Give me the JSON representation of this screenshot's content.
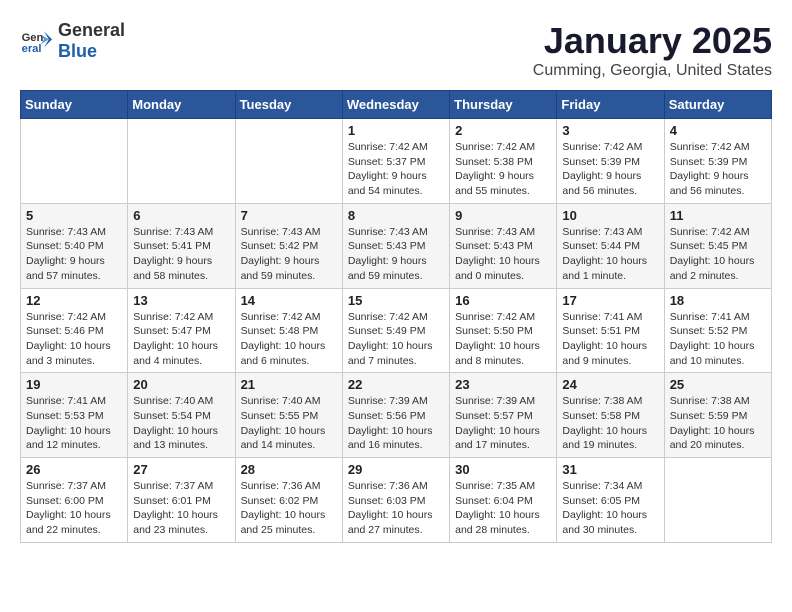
{
  "header": {
    "logo_general": "General",
    "logo_blue": "Blue",
    "month_title": "January 2025",
    "location": "Cumming, Georgia, United States"
  },
  "weekdays": [
    "Sunday",
    "Monday",
    "Tuesday",
    "Wednesday",
    "Thursday",
    "Friday",
    "Saturday"
  ],
  "weeks": [
    [
      {
        "day": "",
        "info": ""
      },
      {
        "day": "",
        "info": ""
      },
      {
        "day": "",
        "info": ""
      },
      {
        "day": "1",
        "info": "Sunrise: 7:42 AM\nSunset: 5:37 PM\nDaylight: 9 hours\nand 54 minutes."
      },
      {
        "day": "2",
        "info": "Sunrise: 7:42 AM\nSunset: 5:38 PM\nDaylight: 9 hours\nand 55 minutes."
      },
      {
        "day": "3",
        "info": "Sunrise: 7:42 AM\nSunset: 5:39 PM\nDaylight: 9 hours\nand 56 minutes."
      },
      {
        "day": "4",
        "info": "Sunrise: 7:42 AM\nSunset: 5:39 PM\nDaylight: 9 hours\nand 56 minutes."
      }
    ],
    [
      {
        "day": "5",
        "info": "Sunrise: 7:43 AM\nSunset: 5:40 PM\nDaylight: 9 hours\nand 57 minutes."
      },
      {
        "day": "6",
        "info": "Sunrise: 7:43 AM\nSunset: 5:41 PM\nDaylight: 9 hours\nand 58 minutes."
      },
      {
        "day": "7",
        "info": "Sunrise: 7:43 AM\nSunset: 5:42 PM\nDaylight: 9 hours\nand 59 minutes."
      },
      {
        "day": "8",
        "info": "Sunrise: 7:43 AM\nSunset: 5:43 PM\nDaylight: 9 hours\nand 59 minutes."
      },
      {
        "day": "9",
        "info": "Sunrise: 7:43 AM\nSunset: 5:43 PM\nDaylight: 10 hours\nand 0 minutes."
      },
      {
        "day": "10",
        "info": "Sunrise: 7:43 AM\nSunset: 5:44 PM\nDaylight: 10 hours\nand 1 minute."
      },
      {
        "day": "11",
        "info": "Sunrise: 7:42 AM\nSunset: 5:45 PM\nDaylight: 10 hours\nand 2 minutes."
      }
    ],
    [
      {
        "day": "12",
        "info": "Sunrise: 7:42 AM\nSunset: 5:46 PM\nDaylight: 10 hours\nand 3 minutes."
      },
      {
        "day": "13",
        "info": "Sunrise: 7:42 AM\nSunset: 5:47 PM\nDaylight: 10 hours\nand 4 minutes."
      },
      {
        "day": "14",
        "info": "Sunrise: 7:42 AM\nSunset: 5:48 PM\nDaylight: 10 hours\nand 6 minutes."
      },
      {
        "day": "15",
        "info": "Sunrise: 7:42 AM\nSunset: 5:49 PM\nDaylight: 10 hours\nand 7 minutes."
      },
      {
        "day": "16",
        "info": "Sunrise: 7:42 AM\nSunset: 5:50 PM\nDaylight: 10 hours\nand 8 minutes."
      },
      {
        "day": "17",
        "info": "Sunrise: 7:41 AM\nSunset: 5:51 PM\nDaylight: 10 hours\nand 9 minutes."
      },
      {
        "day": "18",
        "info": "Sunrise: 7:41 AM\nSunset: 5:52 PM\nDaylight: 10 hours\nand 10 minutes."
      }
    ],
    [
      {
        "day": "19",
        "info": "Sunrise: 7:41 AM\nSunset: 5:53 PM\nDaylight: 10 hours\nand 12 minutes."
      },
      {
        "day": "20",
        "info": "Sunrise: 7:40 AM\nSunset: 5:54 PM\nDaylight: 10 hours\nand 13 minutes."
      },
      {
        "day": "21",
        "info": "Sunrise: 7:40 AM\nSunset: 5:55 PM\nDaylight: 10 hours\nand 14 minutes."
      },
      {
        "day": "22",
        "info": "Sunrise: 7:39 AM\nSunset: 5:56 PM\nDaylight: 10 hours\nand 16 minutes."
      },
      {
        "day": "23",
        "info": "Sunrise: 7:39 AM\nSunset: 5:57 PM\nDaylight: 10 hours\nand 17 minutes."
      },
      {
        "day": "24",
        "info": "Sunrise: 7:38 AM\nSunset: 5:58 PM\nDaylight: 10 hours\nand 19 minutes."
      },
      {
        "day": "25",
        "info": "Sunrise: 7:38 AM\nSunset: 5:59 PM\nDaylight: 10 hours\nand 20 minutes."
      }
    ],
    [
      {
        "day": "26",
        "info": "Sunrise: 7:37 AM\nSunset: 6:00 PM\nDaylight: 10 hours\nand 22 minutes."
      },
      {
        "day": "27",
        "info": "Sunrise: 7:37 AM\nSunset: 6:01 PM\nDaylight: 10 hours\nand 23 minutes."
      },
      {
        "day": "28",
        "info": "Sunrise: 7:36 AM\nSunset: 6:02 PM\nDaylight: 10 hours\nand 25 minutes."
      },
      {
        "day": "29",
        "info": "Sunrise: 7:36 AM\nSunset: 6:03 PM\nDaylight: 10 hours\nand 27 minutes."
      },
      {
        "day": "30",
        "info": "Sunrise: 7:35 AM\nSunset: 6:04 PM\nDaylight: 10 hours\nand 28 minutes."
      },
      {
        "day": "31",
        "info": "Sunrise: 7:34 AM\nSunset: 6:05 PM\nDaylight: 10 hours\nand 30 minutes."
      },
      {
        "day": "",
        "info": ""
      }
    ]
  ]
}
